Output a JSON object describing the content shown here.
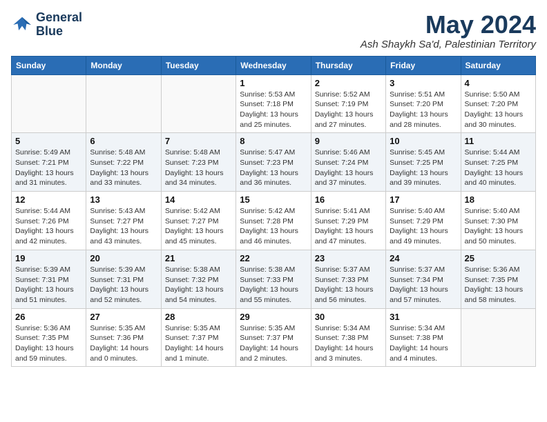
{
  "logo": {
    "line1": "General",
    "line2": "Blue"
  },
  "title": "May 2024",
  "location": "Ash Shaykh Sa'd, Palestinian Territory",
  "weekdays": [
    "Sunday",
    "Monday",
    "Tuesday",
    "Wednesday",
    "Thursday",
    "Friday",
    "Saturday"
  ],
  "weeks": [
    [
      {
        "day": "",
        "info": ""
      },
      {
        "day": "",
        "info": ""
      },
      {
        "day": "",
        "info": ""
      },
      {
        "day": "1",
        "info": "Sunrise: 5:53 AM\nSunset: 7:18 PM\nDaylight: 13 hours\nand 25 minutes."
      },
      {
        "day": "2",
        "info": "Sunrise: 5:52 AM\nSunset: 7:19 PM\nDaylight: 13 hours\nand 27 minutes."
      },
      {
        "day": "3",
        "info": "Sunrise: 5:51 AM\nSunset: 7:20 PM\nDaylight: 13 hours\nand 28 minutes."
      },
      {
        "day": "4",
        "info": "Sunrise: 5:50 AM\nSunset: 7:20 PM\nDaylight: 13 hours\nand 30 minutes."
      }
    ],
    [
      {
        "day": "5",
        "info": "Sunrise: 5:49 AM\nSunset: 7:21 PM\nDaylight: 13 hours\nand 31 minutes."
      },
      {
        "day": "6",
        "info": "Sunrise: 5:48 AM\nSunset: 7:22 PM\nDaylight: 13 hours\nand 33 minutes."
      },
      {
        "day": "7",
        "info": "Sunrise: 5:48 AM\nSunset: 7:23 PM\nDaylight: 13 hours\nand 34 minutes."
      },
      {
        "day": "8",
        "info": "Sunrise: 5:47 AM\nSunset: 7:23 PM\nDaylight: 13 hours\nand 36 minutes."
      },
      {
        "day": "9",
        "info": "Sunrise: 5:46 AM\nSunset: 7:24 PM\nDaylight: 13 hours\nand 37 minutes."
      },
      {
        "day": "10",
        "info": "Sunrise: 5:45 AM\nSunset: 7:25 PM\nDaylight: 13 hours\nand 39 minutes."
      },
      {
        "day": "11",
        "info": "Sunrise: 5:44 AM\nSunset: 7:25 PM\nDaylight: 13 hours\nand 40 minutes."
      }
    ],
    [
      {
        "day": "12",
        "info": "Sunrise: 5:44 AM\nSunset: 7:26 PM\nDaylight: 13 hours\nand 42 minutes."
      },
      {
        "day": "13",
        "info": "Sunrise: 5:43 AM\nSunset: 7:27 PM\nDaylight: 13 hours\nand 43 minutes."
      },
      {
        "day": "14",
        "info": "Sunrise: 5:42 AM\nSunset: 7:27 PM\nDaylight: 13 hours\nand 45 minutes."
      },
      {
        "day": "15",
        "info": "Sunrise: 5:42 AM\nSunset: 7:28 PM\nDaylight: 13 hours\nand 46 minutes."
      },
      {
        "day": "16",
        "info": "Sunrise: 5:41 AM\nSunset: 7:29 PM\nDaylight: 13 hours\nand 47 minutes."
      },
      {
        "day": "17",
        "info": "Sunrise: 5:40 AM\nSunset: 7:29 PM\nDaylight: 13 hours\nand 49 minutes."
      },
      {
        "day": "18",
        "info": "Sunrise: 5:40 AM\nSunset: 7:30 PM\nDaylight: 13 hours\nand 50 minutes."
      }
    ],
    [
      {
        "day": "19",
        "info": "Sunrise: 5:39 AM\nSunset: 7:31 PM\nDaylight: 13 hours\nand 51 minutes."
      },
      {
        "day": "20",
        "info": "Sunrise: 5:39 AM\nSunset: 7:31 PM\nDaylight: 13 hours\nand 52 minutes."
      },
      {
        "day": "21",
        "info": "Sunrise: 5:38 AM\nSunset: 7:32 PM\nDaylight: 13 hours\nand 54 minutes."
      },
      {
        "day": "22",
        "info": "Sunrise: 5:38 AM\nSunset: 7:33 PM\nDaylight: 13 hours\nand 55 minutes."
      },
      {
        "day": "23",
        "info": "Sunrise: 5:37 AM\nSunset: 7:33 PM\nDaylight: 13 hours\nand 56 minutes."
      },
      {
        "day": "24",
        "info": "Sunrise: 5:37 AM\nSunset: 7:34 PM\nDaylight: 13 hours\nand 57 minutes."
      },
      {
        "day": "25",
        "info": "Sunrise: 5:36 AM\nSunset: 7:35 PM\nDaylight: 13 hours\nand 58 minutes."
      }
    ],
    [
      {
        "day": "26",
        "info": "Sunrise: 5:36 AM\nSunset: 7:35 PM\nDaylight: 13 hours\nand 59 minutes."
      },
      {
        "day": "27",
        "info": "Sunrise: 5:35 AM\nSunset: 7:36 PM\nDaylight: 14 hours\nand 0 minutes."
      },
      {
        "day": "28",
        "info": "Sunrise: 5:35 AM\nSunset: 7:37 PM\nDaylight: 14 hours\nand 1 minute."
      },
      {
        "day": "29",
        "info": "Sunrise: 5:35 AM\nSunset: 7:37 PM\nDaylight: 14 hours\nand 2 minutes."
      },
      {
        "day": "30",
        "info": "Sunrise: 5:34 AM\nSunset: 7:38 PM\nDaylight: 14 hours\nand 3 minutes."
      },
      {
        "day": "31",
        "info": "Sunrise: 5:34 AM\nSunset: 7:38 PM\nDaylight: 14 hours\nand 4 minutes."
      },
      {
        "day": "",
        "info": ""
      }
    ]
  ]
}
